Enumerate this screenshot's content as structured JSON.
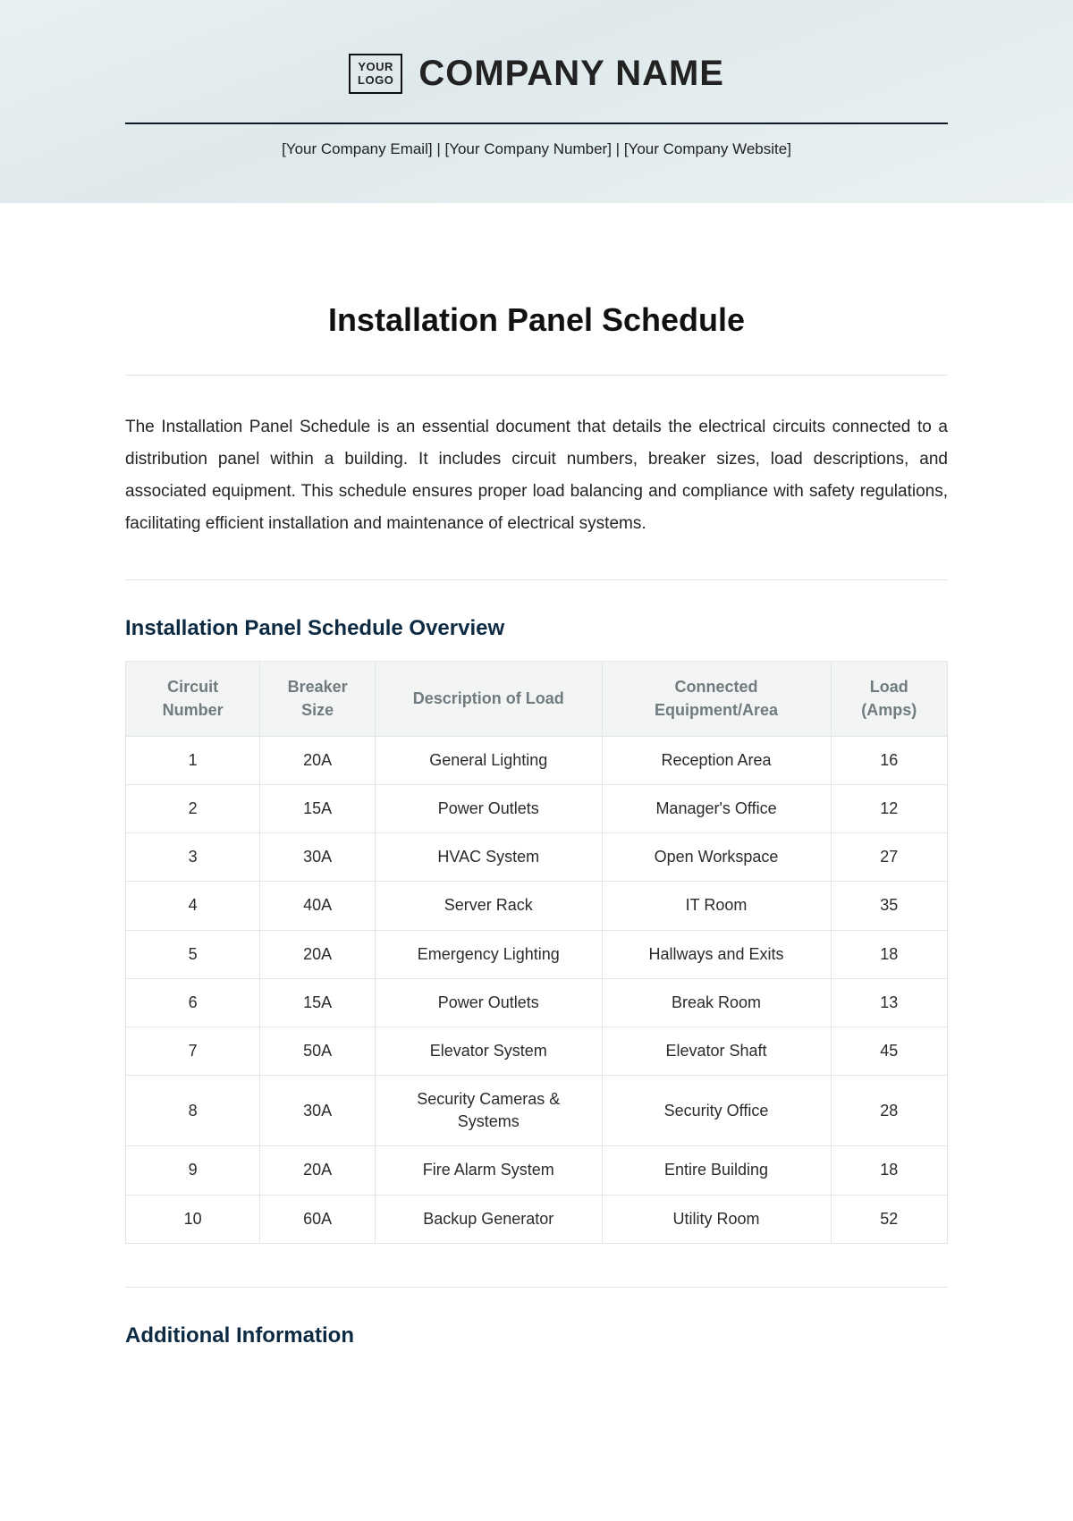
{
  "header": {
    "logo_line1": "YOUR",
    "logo_line2": "LOGO",
    "company_name": "COMPANY NAME",
    "contact_email": "[Your Company Email]",
    "contact_number": "[Your Company Number]",
    "contact_website": "[Your Company Website]",
    "sep": " | "
  },
  "page": {
    "title": "Installation Panel Schedule",
    "intro": "The Installation Panel Schedule is an essential document that details the electrical circuits connected to a distribution panel within a building. It includes circuit numbers, breaker sizes, load descriptions, and associated equipment. This schedule ensures proper load balancing and compliance with safety regulations, facilitating efficient installation and maintenance of electrical systems."
  },
  "overview": {
    "heading": "Installation Panel Schedule Overview",
    "columns": [
      "Circuit Number",
      "Breaker Size",
      "Description of Load",
      "Connected Equipment/Area",
      "Load (Amps)"
    ],
    "rows": [
      {
        "circuit": "1",
        "breaker": "20A",
        "desc": "General Lighting",
        "area": "Reception Area",
        "load": "16"
      },
      {
        "circuit": "2",
        "breaker": "15A",
        "desc": "Power Outlets",
        "area": "Manager's Office",
        "load": "12"
      },
      {
        "circuit": "3",
        "breaker": "30A",
        "desc": "HVAC System",
        "area": "Open Workspace",
        "load": "27"
      },
      {
        "circuit": "4",
        "breaker": "40A",
        "desc": "Server Rack",
        "area": "IT Room",
        "load": "35"
      },
      {
        "circuit": "5",
        "breaker": "20A",
        "desc": "Emergency Lighting",
        "area": "Hallways and Exits",
        "load": "18"
      },
      {
        "circuit": "6",
        "breaker": "15A",
        "desc": "Power Outlets",
        "area": "Break Room",
        "load": "13"
      },
      {
        "circuit": "7",
        "breaker": "50A",
        "desc": "Elevator System",
        "area": "Elevator Shaft",
        "load": "45"
      },
      {
        "circuit": "8",
        "breaker": "30A",
        "desc": "Security Cameras & Systems",
        "area": "Security Office",
        "load": "28"
      },
      {
        "circuit": "9",
        "breaker": "20A",
        "desc": "Fire Alarm System",
        "area": "Entire Building",
        "load": "18"
      },
      {
        "circuit": "10",
        "breaker": "60A",
        "desc": "Backup Generator",
        "area": "Utility Room",
        "load": "52"
      }
    ]
  },
  "additional": {
    "heading": "Additional Information"
  }
}
